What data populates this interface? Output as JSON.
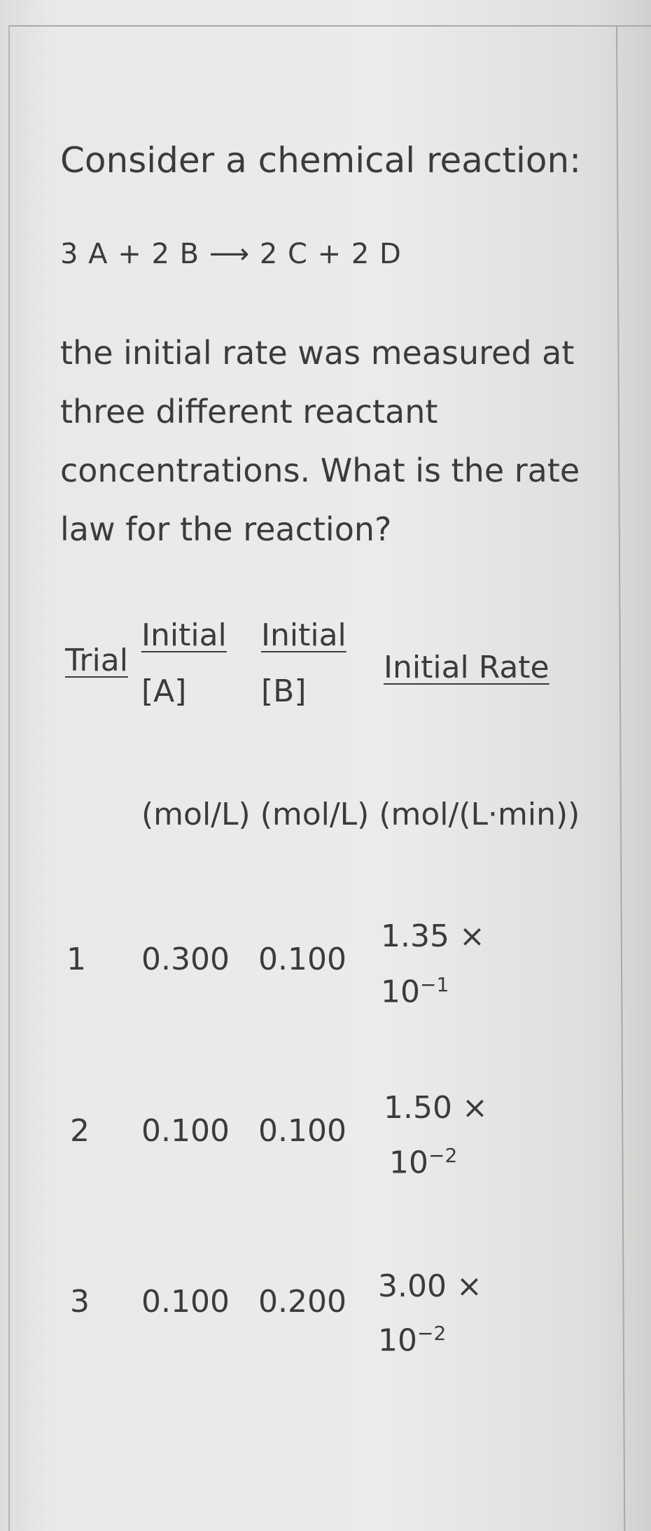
{
  "question": {
    "title": "Consider a chemical reaction:",
    "equation": "3 A + 2 B ⟶ 2 C + 2 D",
    "body": "the initial rate was measured at three different reactant concentrations. What is the rate law for the reaction?"
  },
  "table": {
    "headers": {
      "trial": "Trial",
      "a_line1": "Initial",
      "a_line2": "[A]",
      "b_line1": "Initial",
      "b_line2": "[B]",
      "rate": "Initial Rate"
    },
    "units": "(mol/L) (mol/L) (mol/(L·min))",
    "rows": [
      {
        "trial": "1",
        "a": "0.300",
        "b": "0.100",
        "rate_mantissa": "1.35 ×",
        "rate_base": "10",
        "rate_exp": "−1"
      },
      {
        "trial": "2",
        "a": "0.100",
        "b": "0.100",
        "rate_mantissa": "1.50 ×",
        "rate_base": "10",
        "rate_exp": "−2"
      },
      {
        "trial": "3",
        "a": "0.100",
        "b": "0.200",
        "rate_mantissa": "3.00 ×",
        "rate_base": "10",
        "rate_exp": "−2"
      }
    ]
  }
}
